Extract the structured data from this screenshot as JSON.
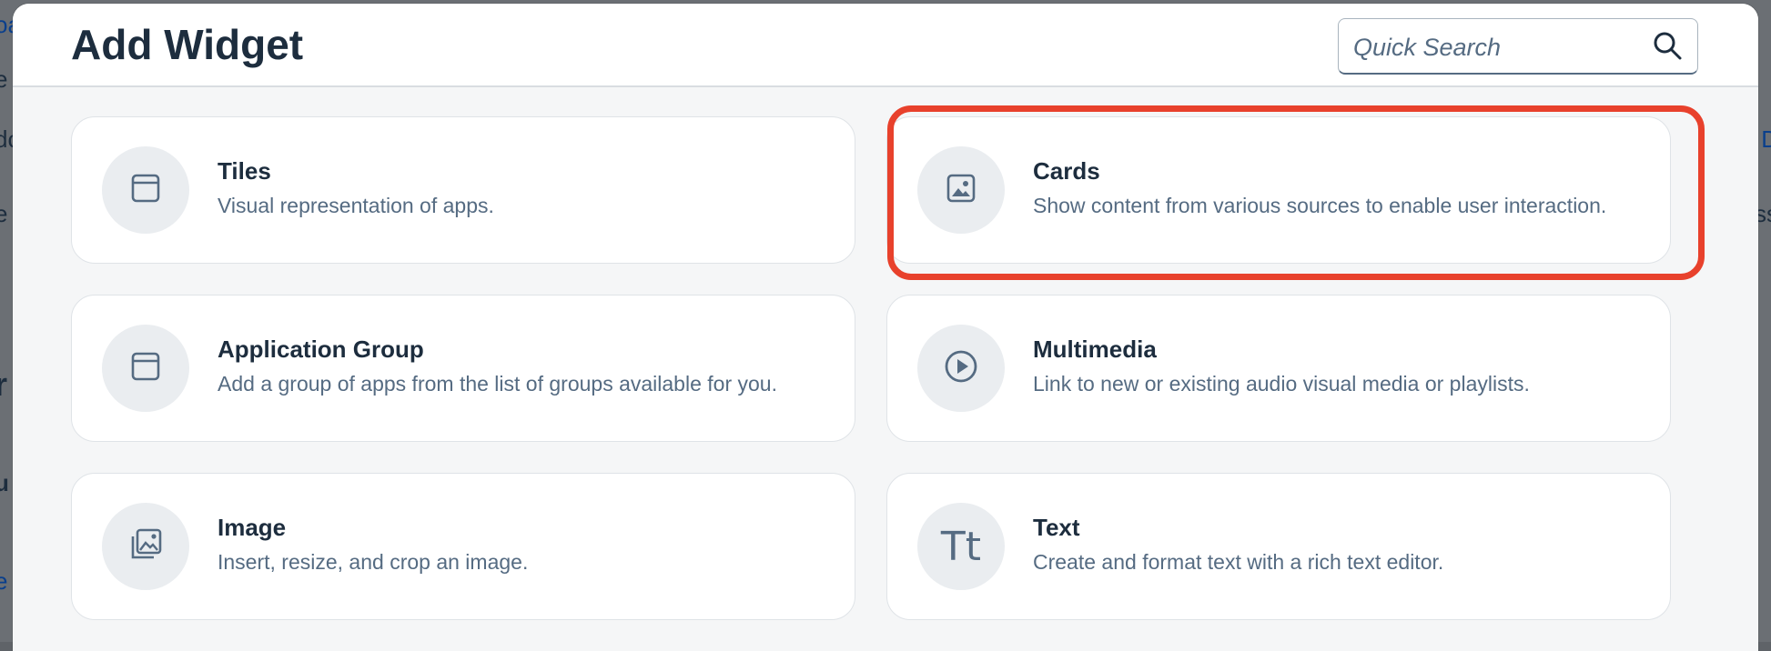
{
  "background": {
    "left_fragments": [
      "oa",
      "e",
      "dc",
      "e",
      "r",
      "u",
      "e"
    ],
    "right_fragments": [
      "D",
      "ss"
    ]
  },
  "dialog": {
    "title": "Add Widget",
    "search": {
      "placeholder": "Quick Search",
      "value": ""
    }
  },
  "widgets": [
    {
      "title": "Tiles",
      "description": "Visual representation of apps.",
      "icon": "tile-icon"
    },
    {
      "title": "Cards",
      "description": "Show content from various sources to enable user interaction.",
      "icon": "card-image-icon",
      "highlighted": true
    },
    {
      "title": "Application Group",
      "description": "Add a group of apps from the list of groups available for you.",
      "icon": "tile-icon"
    },
    {
      "title": "Multimedia",
      "description": "Link to new or existing audio visual media or playlists.",
      "icon": "play-icon"
    },
    {
      "title": "Image",
      "description": "Insert, resize, and crop an image.",
      "icon": "image-gallery-icon"
    },
    {
      "title": "Text",
      "description": "Create and format text with a rich text editor.",
      "icon": "text-icon",
      "glyph": "Tt"
    }
  ],
  "colors": {
    "highlight": "#e8412c",
    "title": "#1d2d3e",
    "muted": "#556b82"
  }
}
